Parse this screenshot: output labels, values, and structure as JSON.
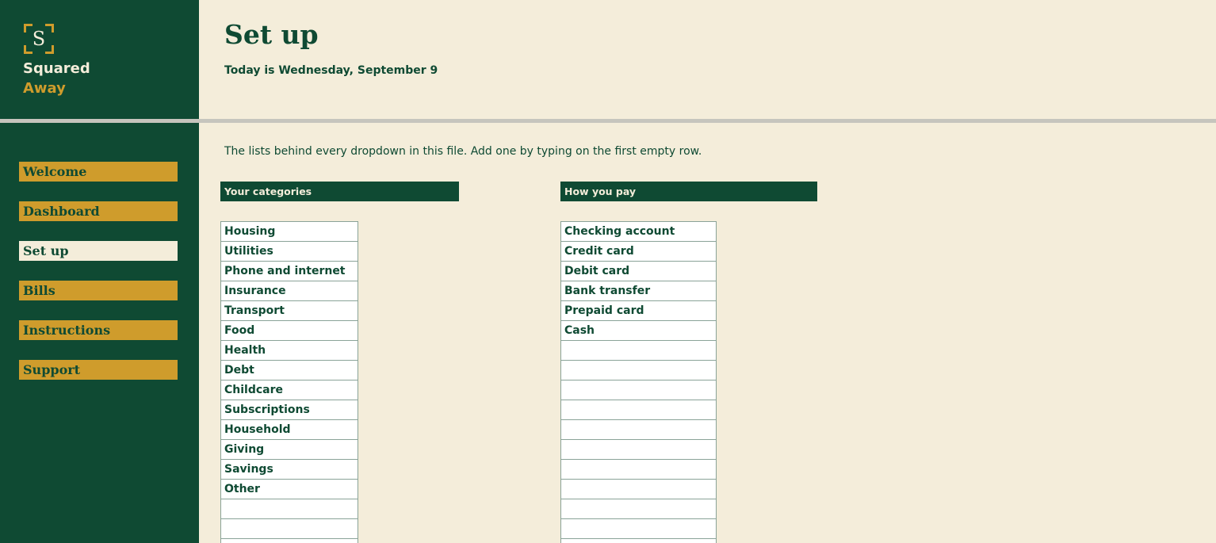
{
  "brand": {
    "logo_letter": "S",
    "name_line1": "Squared",
    "name_line2": "Away",
    "colors": {
      "primary": "#0f4a33",
      "accent": "#cf9c2c",
      "paper": "#f4edda"
    }
  },
  "nav": {
    "items": [
      {
        "label": "Welcome",
        "active": false
      },
      {
        "label": "Dashboard",
        "active": false
      },
      {
        "label": "Set up",
        "active": true
      },
      {
        "label": "Bills",
        "active": false
      },
      {
        "label": "Instructions",
        "active": false
      },
      {
        "label": "Support",
        "active": false
      }
    ]
  },
  "header": {
    "title": "Set up",
    "date_text": "Today is Wednesday, September 9"
  },
  "intro": "The lists behind every dropdown in this file. Add one by typing on the first empty row.",
  "categories": {
    "heading": "Your categories",
    "items": [
      "Housing",
      "Utilities",
      "Phone and internet",
      "Insurance",
      "Transport",
      "Food",
      "Health",
      "Debt",
      "Childcare",
      "Subscriptions",
      "Household",
      "Giving",
      "Savings",
      "Other",
      "",
      "",
      ""
    ]
  },
  "payments": {
    "heading": "How you pay",
    "items": [
      "Checking account",
      "Credit card",
      "Debit card",
      "Bank transfer",
      "Prepaid card",
      "Cash",
      "",
      "",
      "",
      "",
      "",
      "",
      "",
      "",
      "",
      "",
      ""
    ]
  }
}
